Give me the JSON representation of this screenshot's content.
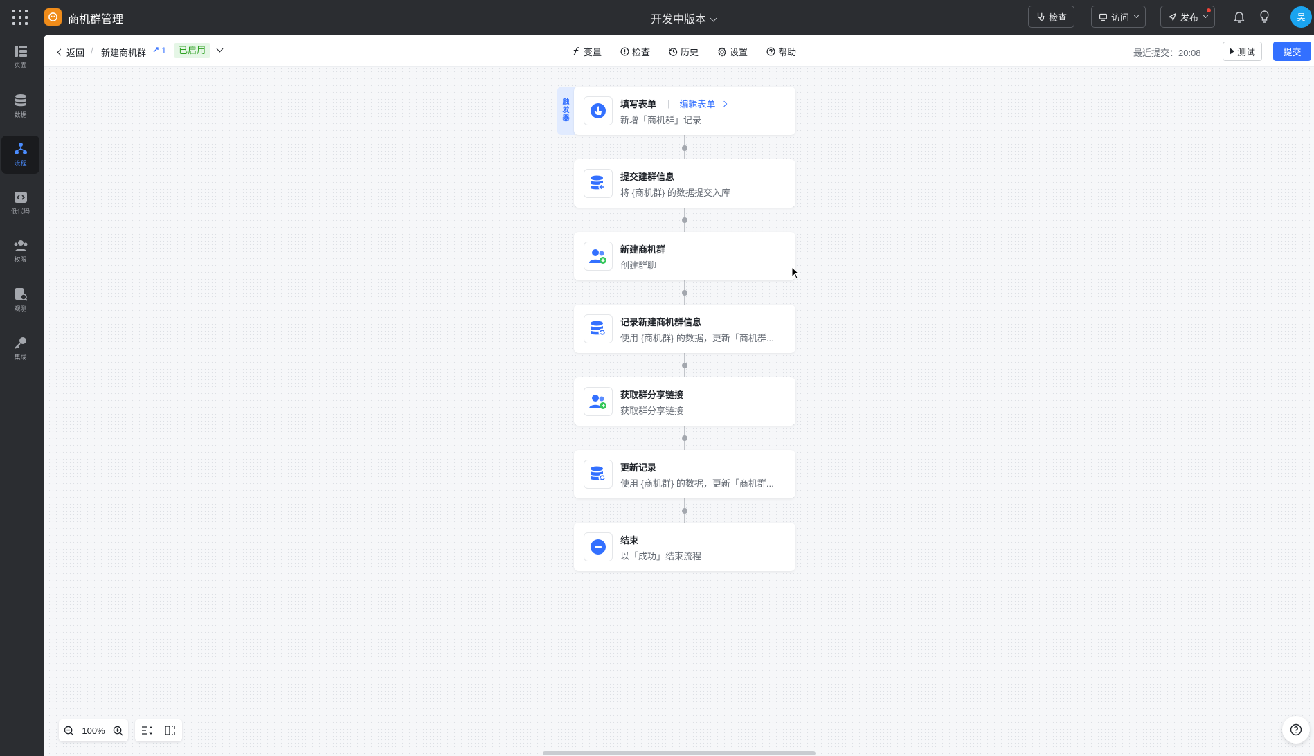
{
  "header": {
    "app_title": "商机群管理",
    "version_label": "开发中版本",
    "check_label": "检查",
    "visit_label": "访问",
    "publish_label": "发布",
    "avatar_text": "吴"
  },
  "rail": {
    "items": [
      {
        "label": "页面",
        "icon": "pages-icon"
      },
      {
        "label": "数据",
        "icon": "database-icon"
      },
      {
        "label": "流程",
        "icon": "flow-icon",
        "active": true
      },
      {
        "label": "低代码",
        "icon": "lowcode-icon"
      },
      {
        "label": "权限",
        "icon": "users-icon"
      },
      {
        "label": "观测",
        "icon": "observe-icon"
      },
      {
        "label": "集成",
        "icon": "key-icon"
      }
    ]
  },
  "toolbar": {
    "back_label": "返回",
    "workflow_name": "新建商机群",
    "version_num": "1",
    "status": "已启用",
    "tools": [
      "变量",
      "检查",
      "历史",
      "设置",
      "帮助"
    ],
    "last_submit": "最近提交：20:08",
    "test_label": "测试",
    "submit_label": "提交"
  },
  "flow": {
    "trigger_tab": [
      "触",
      "发",
      "器"
    ],
    "edit_form_label": "编辑表单",
    "nodes": [
      {
        "title": "填写表单",
        "desc": "新增「商机群」记录",
        "icon": "hand-pointer-icon"
      },
      {
        "title": "提交建群信息",
        "desc": "将 {商机群} 的数据提交入库",
        "icon": "database-import-icon"
      },
      {
        "title": "新建商机群",
        "desc": "创建群聊",
        "icon": "group-add-icon"
      },
      {
        "title": "记录新建商机群信息",
        "desc": "使用 {商机群} 的数据，更新「商机群...",
        "icon": "database-refresh-icon"
      },
      {
        "title": "获取群分享链接",
        "desc": "获取群分享链接",
        "icon": "group-share-icon"
      },
      {
        "title": "更新记录",
        "desc": "使用 {商机群} 的数据，更新「商机群...",
        "icon": "database-refresh-icon"
      },
      {
        "title": "结束",
        "desc": "以「成功」结束流程",
        "icon": "end-icon"
      }
    ]
  },
  "canvas": {
    "zoom": "100%"
  }
}
